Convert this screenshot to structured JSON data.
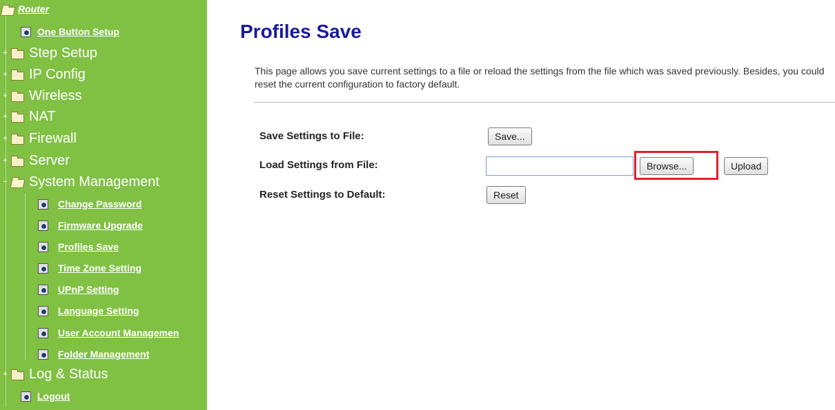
{
  "sidebar": {
    "root_label": "Router",
    "items": [
      {
        "type": "link",
        "label": "One Button Setup"
      },
      {
        "type": "folder",
        "label": "Step Setup"
      },
      {
        "type": "folder",
        "label": "IP Config"
      },
      {
        "type": "folder",
        "label": "Wireless"
      },
      {
        "type": "folder",
        "label": "NAT"
      },
      {
        "type": "folder",
        "label": "Firewall"
      },
      {
        "type": "folder",
        "label": "Server"
      },
      {
        "type": "folder-open",
        "label": "System Management"
      },
      {
        "type": "sublink",
        "label": "Change Password"
      },
      {
        "type": "sublink",
        "label": "Firmware Upgrade"
      },
      {
        "type": "sublink",
        "label": "Profiles Save"
      },
      {
        "type": "sublink",
        "label": "Time Zone Setting"
      },
      {
        "type": "sublink",
        "label": "UPnP Setting"
      },
      {
        "type": "sublink",
        "label": "Language Setting"
      },
      {
        "type": "sublink",
        "label": "User Account Managemen"
      },
      {
        "type": "sublink",
        "label": "Folder Management"
      },
      {
        "type": "folder",
        "label": "Log & Status"
      },
      {
        "type": "link",
        "label": "Logout"
      }
    ]
  },
  "main": {
    "title": "Profiles Save",
    "description": "This page allows you save current settings to a file or reload the settings from the file which was saved previously. Besides, you could reset the current configuration to factory default.",
    "save_label": "Save Settings to File:",
    "save_button": "Save...",
    "load_label": "Load Settings from File:",
    "file_value": "",
    "browse_button": "Browse...",
    "upload_button": "Upload",
    "reset_label": "Reset Settings to Default:",
    "reset_button": "Reset"
  },
  "colors": {
    "sidebar_bg": "#80c043",
    "title": "#1a1a9c",
    "highlight": "#e3202a"
  }
}
